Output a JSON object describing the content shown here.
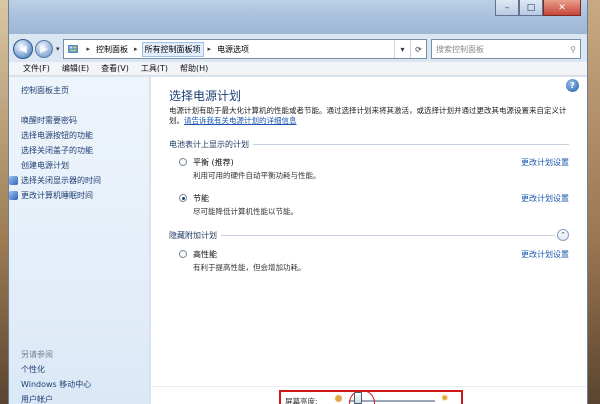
{
  "window": {
    "controls": {
      "minimize": "–",
      "maximize": "□",
      "close": "✕"
    }
  },
  "nav": {
    "back_icon": "back-arrow-icon",
    "forward_icon": "forward-arrow-icon",
    "breadcrumb": [
      "控制面板",
      "所有控制面板项",
      "电源选项"
    ],
    "search_placeholder": "搜索控制面板"
  },
  "menubar": {
    "items": [
      "文件(F)",
      "编辑(E)",
      "查看(V)",
      "工具(T)",
      "帮助(H)"
    ]
  },
  "sidebar": {
    "home": "控制面板主页",
    "links": [
      "唤醒时需要密码",
      "选择电源按钮的功能",
      "选择关闭盖子的功能",
      "创建电源计划",
      "选择关闭显示器的时间",
      "更改计算机睡眠时间"
    ],
    "see_also": "另请参阅",
    "see_also_links": [
      "个性化",
      "Windows 移动中心",
      "用户帐户"
    ]
  },
  "main": {
    "title": "选择电源计划",
    "description": "电源计划有助于最大化计算机的性能或者节能。通过选择计划来将其激活，或选择计划并通过更改其电源设置来自定义计划。",
    "description_link": "请告诉我有关电源计划的详细信息",
    "group1_label": "电池表计上显示的计划",
    "group2_label": "隐藏附加计划",
    "plans": [
      {
        "name": "平衡 (推荐)",
        "desc": "利用可用的硬件自动平衡功耗与性能。",
        "change": "更改计划设置",
        "selected": false
      },
      {
        "name": "节能",
        "desc": "尽可能降低计算机性能以节能。",
        "change": "更改计划设置",
        "selected": true
      },
      {
        "name": "高性能",
        "desc": "有利于提高性能，但会增加功耗。",
        "change": "更改计划设置",
        "selected": false
      }
    ],
    "brightness_label": "屏幕亮度:",
    "brightness_level": 0.1
  },
  "colors": {
    "accent": "#1c56b0",
    "highlight_box": "#d01818"
  }
}
